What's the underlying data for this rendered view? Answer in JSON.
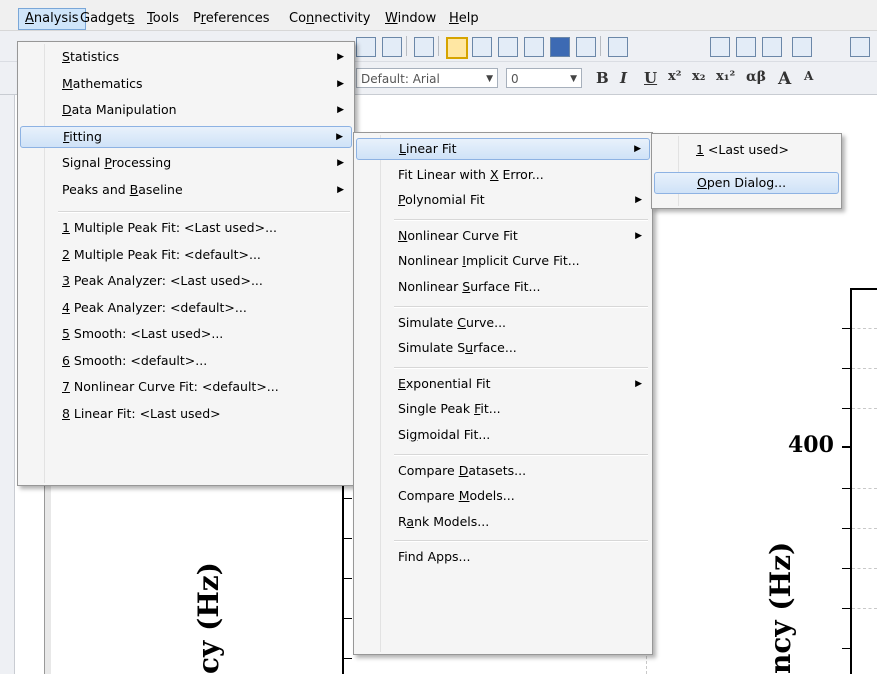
{
  "menubar": {
    "items": [
      {
        "label": "Analysis",
        "u": 0
      },
      {
        "label": "Gadgets",
        "u": 6
      },
      {
        "label": "Tools",
        "u": 0
      },
      {
        "label": "Preferences",
        "u": 1
      },
      {
        "label": "Connectivity",
        "u": 2
      },
      {
        "label": "Window",
        "u": 0
      },
      {
        "label": "Help",
        "u": 0
      }
    ]
  },
  "toolbar": {
    "font_combo": "Default: Arial",
    "size_combo": "0",
    "format_labels": [
      "B",
      "I",
      "U",
      "x²",
      "x₂",
      "x₁²",
      "αβ",
      "A",
      "A"
    ]
  },
  "analysis_menu": {
    "items": [
      {
        "label": "Statistics",
        "u": 0,
        "submenu": true
      },
      {
        "label": "Mathematics",
        "u": 0,
        "submenu": true
      },
      {
        "label": "Data Manipulation",
        "u": 0,
        "submenu": true
      },
      {
        "label": "Fitting",
        "u": 0,
        "submenu": true,
        "highlighted": true
      },
      {
        "label": "Signal Processing",
        "u": 7,
        "submenu": true
      },
      {
        "label": "Peaks and Baseline",
        "u": 10,
        "submenu": true
      },
      {
        "sep": true
      },
      {
        "label": "1 Multiple Peak Fit: <Last used>...",
        "u": 0
      },
      {
        "label": "2 Multiple Peak Fit: <default>...",
        "u": 0
      },
      {
        "label": "3 Peak Analyzer: <Last used>...",
        "u": 0
      },
      {
        "label": "4 Peak Analyzer: <default>...",
        "u": 0
      },
      {
        "label": "5 Smooth: <Last used>...",
        "u": 0
      },
      {
        "label": "6 Smooth: <default>...",
        "u": 0
      },
      {
        "label": "7 Nonlinear Curve Fit: <default>...",
        "u": 0
      },
      {
        "label": "8 Linear Fit: <Last used>",
        "u": 0
      }
    ]
  },
  "fitting_menu": {
    "items": [
      {
        "label": "Linear Fit",
        "u": 0,
        "submenu": true,
        "highlighted": true
      },
      {
        "label": "Fit Linear with X Error...",
        "u": 16
      },
      {
        "label": "Polynomial Fit",
        "u": 0,
        "submenu": true
      },
      {
        "sep": true
      },
      {
        "label": "Nonlinear Curve Fit",
        "u": 0,
        "submenu": true
      },
      {
        "label": "Nonlinear Implicit Curve Fit...",
        "u": 10
      },
      {
        "label": "Nonlinear Surface Fit...",
        "u": 10
      },
      {
        "sep": true
      },
      {
        "label": "Simulate Curve...",
        "u": 9
      },
      {
        "label": "Simulate Surface...",
        "u": 10
      },
      {
        "sep": true
      },
      {
        "label": "Exponential Fit",
        "u": 0,
        "submenu": true
      },
      {
        "label": "Single Peak Fit...",
        "u": 12
      },
      {
        "label": "Sigmoidal Fit...",
        "u": 2
      },
      {
        "sep": true
      },
      {
        "label": "Compare Datasets...",
        "u": 8
      },
      {
        "label": "Compare Models...",
        "u": 8
      },
      {
        "label": "Rank Models...",
        "u": 1
      },
      {
        "sep": true
      },
      {
        "label": "Find Apps...",
        "u": -1
      }
    ]
  },
  "linearfit_menu": {
    "items": [
      {
        "label": "1 <Last used>",
        "u": 0
      },
      {
        "label": "Open Dialog...",
        "u": 0,
        "highlighted": true
      }
    ]
  },
  "graph": {
    "ytitle_left": "cy (Hz)",
    "ytitle_right": "ncy (Hz)",
    "tick_400": "400"
  }
}
